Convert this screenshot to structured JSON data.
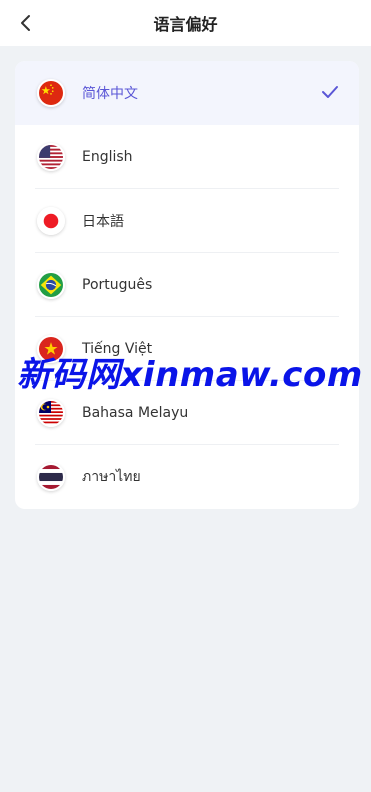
{
  "header": {
    "title": "语言偏好",
    "back_icon": "chevron-left-icon"
  },
  "accent_color": "#5a56d6",
  "languages": [
    {
      "label": "简体中文",
      "flag": "china-flag-icon",
      "selected": true
    },
    {
      "label": "English",
      "flag": "usa-flag-icon",
      "selected": false
    },
    {
      "label": "日本語",
      "flag": "japan-flag-icon",
      "selected": false
    },
    {
      "label": "Português",
      "flag": "brazil-flag-icon",
      "selected": false
    },
    {
      "label": "Tiếng Việt",
      "flag": "vietnam-flag-icon",
      "selected": false
    },
    {
      "label": "Bahasa Melayu",
      "flag": "malaysia-flag-icon",
      "selected": false
    },
    {
      "label": "ภาษาไทย",
      "flag": "thailand-flag-icon",
      "selected": false
    }
  ],
  "watermark": "新码网xinmaw.com"
}
